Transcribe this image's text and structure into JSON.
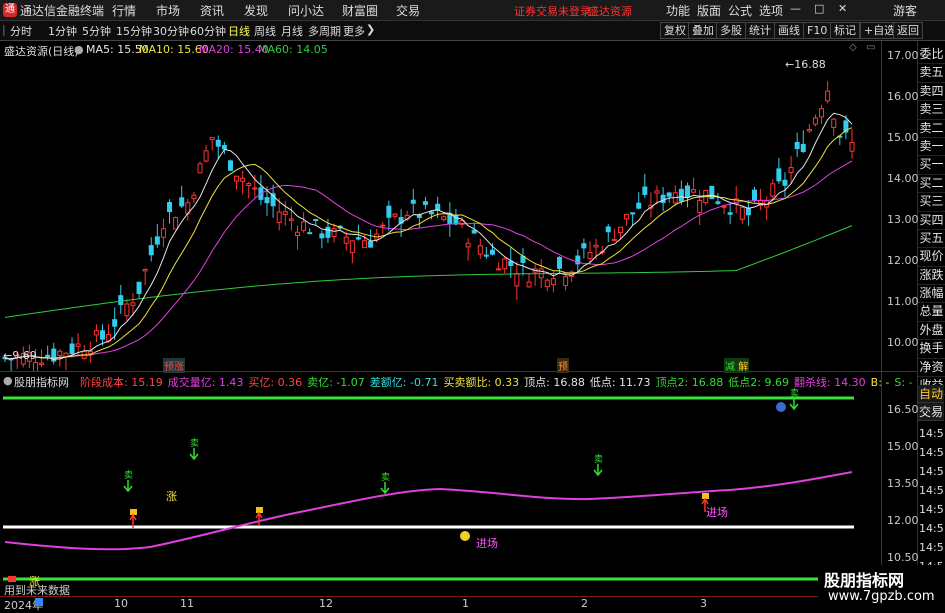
{
  "app": {
    "icon_glyph": "通",
    "title": "通达信金融终端",
    "menus": [
      "行情",
      "市场",
      "资讯",
      "发现",
      "问小达",
      "财富圈",
      "交易"
    ],
    "warn_login": "证券交易未登录",
    "warn_source": "盛达资源",
    "right_menus": [
      "功能",
      "版面",
      "公式",
      "选项"
    ],
    "guest": "游客",
    "window_buttons": [
      "—",
      "□",
      "✕"
    ]
  },
  "toolbar": {
    "periods": [
      "分时",
      "1分钟",
      "5分钟",
      "15分钟",
      "30分钟",
      "60分钟",
      "日线",
      "周线",
      "月线",
      "多周期",
      "更多"
    ],
    "selected": "日线",
    "more_arrow": "❯",
    "right_buttons": [
      "复权",
      "叠加",
      "多股",
      "统计",
      "画线",
      "F10",
      "标记",
      "+自选",
      "返回"
    ]
  },
  "main_chart": {
    "stock_label": "盛达资源(日线)",
    "legend": [
      {
        "label": "MA5: 15.50",
        "color": "#e6e6e6"
      },
      {
        "label": "MA10: 15.60",
        "color": "#f0e23a"
      },
      {
        "label": "MA20: 15.40",
        "color": "#e040e0"
      },
      {
        "label": "MA60: 14.05",
        "color": "#2ecc40"
      }
    ],
    "y_ticks": [
      "17.00",
      "16.00",
      "15.00",
      "14.00",
      "13.00",
      "12.00",
      "11.00",
      "10.00"
    ],
    "high_label": "16.88",
    "low_label": "9.69",
    "markers": [
      {
        "text": "预",
        "color": "#ff4444"
      },
      {
        "text": "预",
        "color": "#ff8833"
      },
      {
        "text": "减",
        "color": "#33dd33"
      },
      {
        "text": "解",
        "color": "#33dd33"
      }
    ]
  },
  "right_tabs": [
    "委比",
    "卖五",
    "卖四",
    "卖三",
    "卖二",
    "卖一",
    "买一",
    "买二",
    "买三",
    "买四",
    "买五",
    "现价",
    "涨跌",
    "涨幅",
    "总量",
    "外盘",
    "换手",
    "净资",
    "收益"
  ],
  "right_tabs_lower": [
    "自动",
    "交易"
  ],
  "right_times": [
    "14:5",
    "14:5",
    "14:5",
    "14:5",
    "14:5",
    "14:5",
    "14:5",
    "14:5",
    "14:5"
  ],
  "indicator": {
    "name": "股朋指标网",
    "legend": [
      {
        "label": "阶段成本: 15.19",
        "color": "#ff4444"
      },
      {
        "label": "成交量亿: 1.43",
        "color": "#e040e0"
      },
      {
        "label": "买亿: 0.36",
        "color": "#ff4444"
      },
      {
        "label": "卖亿: -1.07",
        "color": "#33dd33"
      },
      {
        "label": "差额亿: -0.71",
        "color": "#33dddd"
      },
      {
        "label": "买卖额比: 0.33",
        "color": "#f0e23a"
      },
      {
        "label": "顶点: 16.88",
        "color": "#e6e6e6"
      },
      {
        "label": "低点: 11.73",
        "color": "#e6e6e6"
      },
      {
        "label": "顶点2: 16.88",
        "color": "#33dd33"
      },
      {
        "label": "低点2: 9.69",
        "color": "#33dd33"
      },
      {
        "label": "翻杀线: 14.30",
        "color": "#e040e0"
      },
      {
        "label": "B: -",
        "color": "#f0e23a"
      },
      {
        "label": "S: -",
        "color": "#33dd33"
      }
    ],
    "y_ticks": [
      "16.50",
      "15.00",
      "13.50",
      "12.00",
      "10.50"
    ],
    "sell_glyph": "卖",
    "zhang_glyph": "涨",
    "jinchang": "进场",
    "no_data": "用到未来数据"
  },
  "x_axis": {
    "labels": [
      "2024年",
      "10",
      "11",
      "12",
      "1",
      "2",
      "3"
    ]
  },
  "watermark": {
    "name": "股朋指标网",
    "url": "www.7gpzb.com"
  }
}
